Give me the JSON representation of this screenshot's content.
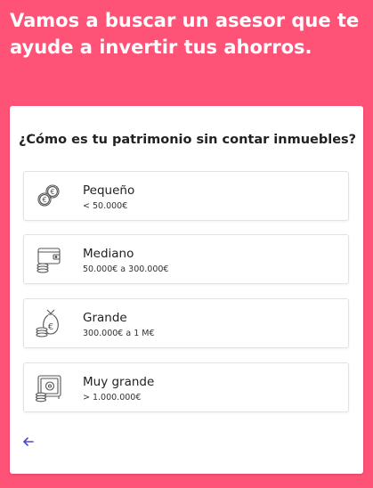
{
  "header": {
    "title": "Vamos a buscar un asesor que te ayude a invertir tus ahorros."
  },
  "card": {
    "question": "¿Cómo es tu patrimonio sin contar inmuebles?",
    "options": [
      {
        "label": "Pequeño",
        "range": "< 50.000€",
        "icon": "coins-euro-icon"
      },
      {
        "label": "Mediano",
        "range": "50.000€ a 300.000€",
        "icon": "wallet-coins-icon"
      },
      {
        "label": "Grande",
        "range": "300.000€ a 1 M€",
        "icon": "money-bag-icon"
      },
      {
        "label": "Muy grande",
        "range": "> 1.000.000€",
        "icon": "safe-icon"
      }
    ],
    "back_icon": "back-arrow-icon"
  },
  "colors": {
    "background": "#ff5277",
    "card": "#ffffff",
    "accent": "#4a4ad0",
    "text": "#222222"
  }
}
